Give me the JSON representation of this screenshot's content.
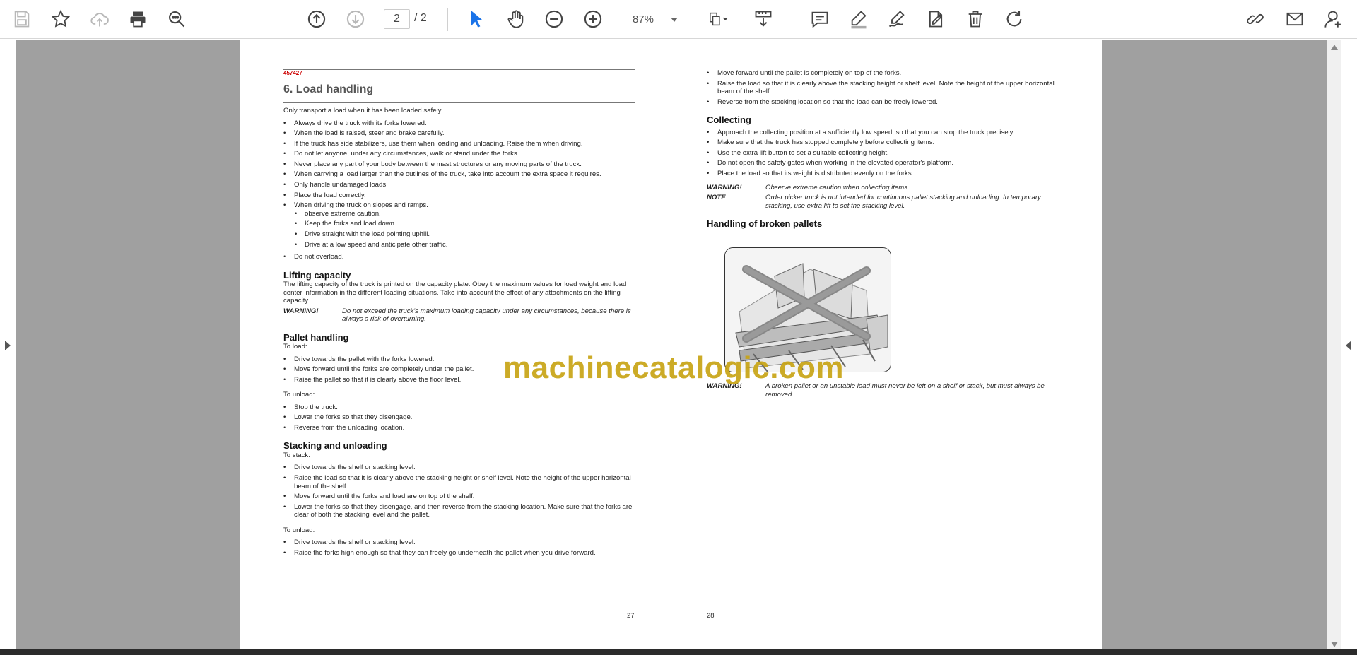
{
  "toolbar": {
    "current_page": "2",
    "page_total": "/ 2",
    "zoom": "87%"
  },
  "colors": {
    "accent": "#1a73e8",
    "viewer_bg": "#a0a0a0",
    "watermark": "#c8a415",
    "doc_code": "#cc0000"
  },
  "icons": [
    "save-icon",
    "bookmark-star-icon",
    "upload-cloud-icon",
    "print-icon",
    "zoom-search-icon",
    "page-up-icon",
    "page-down-icon",
    "select-cursor-icon",
    "hand-icon",
    "zoom-out-icon",
    "zoom-in-icon",
    "page-fit-icon",
    "scroll-mode-icon",
    "comment-icon",
    "highlight-icon",
    "draw-icon",
    "fill-sign-icon",
    "delete-icon",
    "rotate-icon",
    "link-icon",
    "mail-icon",
    "add-user-icon"
  ],
  "watermark": "machinecatalogic.com",
  "page27": {
    "doc_code": "457427",
    "title": "6. Load handling",
    "intro": "Only transport a load when it has been loaded safely.",
    "rules": [
      "Always drive the truck with its forks lowered.",
      "When the load is raised, steer and brake carefully.",
      "If the truck has side stabilizers, use them when loading and unloading. Raise them when driving.",
      "Do not let anyone, under any circumstances, walk or stand under the forks.",
      "Never place any part of your body between the mast structures or any moving parts of the truck.",
      "When carrying a load larger than the outlines of the truck, take into account the extra space it requires.",
      "Only handle undamaged loads.",
      "Place the load correctly.",
      "When driving the truck on slopes and ramps."
    ],
    "slope_rules": [
      "observe extreme caution.",
      "Keep the forks and load down.",
      "Drive straight with the load pointing uphill.",
      "Drive at a low speed and anticipate other traffic."
    ],
    "last_rule": "Do not overload.",
    "lifting": {
      "heading": "Lifting capacity",
      "text": "The lifting capacity of the truck is printed on the capacity plate. Obey the maximum values for load weight and load center information in the different loading situations. Take into account the effect of any attachments on the lifting capacity.",
      "warn_key": "WARNING!",
      "warn_text": "Do not exceed the truck's maximum loading capacity under any circumstances, because there is always a risk of overturning."
    },
    "pallet": {
      "heading": "Pallet handling",
      "to_load": "To load:",
      "load_steps": [
        "Drive towards the pallet with the forks lowered.",
        "Move forward until the forks are completely under the pallet.",
        "Raise the pallet so that it is clearly above the floor level."
      ],
      "to_unload": "To unload:",
      "unload_steps": [
        "Stop the truck.",
        "Lower the forks so that they disengage.",
        "Reverse from the unloading location."
      ]
    },
    "stacking": {
      "heading": "Stacking and unloading",
      "to_stack": "To stack:",
      "stack_steps": [
        "Drive towards the shelf or stacking level.",
        "Raise the load so that it is clearly above the stacking height or shelf level. Note the height of the upper horizontal beam of the shelf.",
        "Move forward until the forks and load are on top of the shelf.",
        "Lower the forks so that they disengage, and then reverse from the stacking location. Make sure that the forks are clear of both the stacking level and the pallet."
      ],
      "to_unload": "To unload:",
      "unload_steps": [
        "Drive towards the shelf or stacking level.",
        "Raise the forks high enough so that they can freely go underneath the pallet when you drive forward."
      ]
    },
    "page_number": "27"
  },
  "page28": {
    "top_steps": [
      "Move forward until the pallet is completely on top of the forks.",
      "Raise the load so that it is clearly above the stacking height or shelf level. Note the height of the upper horizontal beam of the shelf.",
      "Reverse from the stacking location so that the load can be freely lowered."
    ],
    "collecting": {
      "heading": "Collecting",
      "steps": [
        "Approach the collecting position at a sufficiently low speed, so that you can stop the truck precisely.",
        "Make sure that the truck has stopped completely before collecting items.",
        "Use the extra lift button to set a suitable collecting height.",
        "Do not open the safety gates when working in the elevated operator's platform.",
        "Place the load so that its weight is distributed evenly on the forks."
      ],
      "warn_key": "WARNING!",
      "warn_text": "Observe extreme caution when collecting items.",
      "note_key": "NOTE",
      "note_text": "Order picker truck is not intended for continuous pallet stacking and unloading. In temporary stacking, use extra lift to set the stacking level."
    },
    "broken": {
      "heading": "Handling of broken pallets",
      "warn_key": "WARNING!",
      "warn_text": "A broken pallet or an unstable load must never be left on a shelf or stack, but must always be removed."
    },
    "page_number": "28"
  }
}
